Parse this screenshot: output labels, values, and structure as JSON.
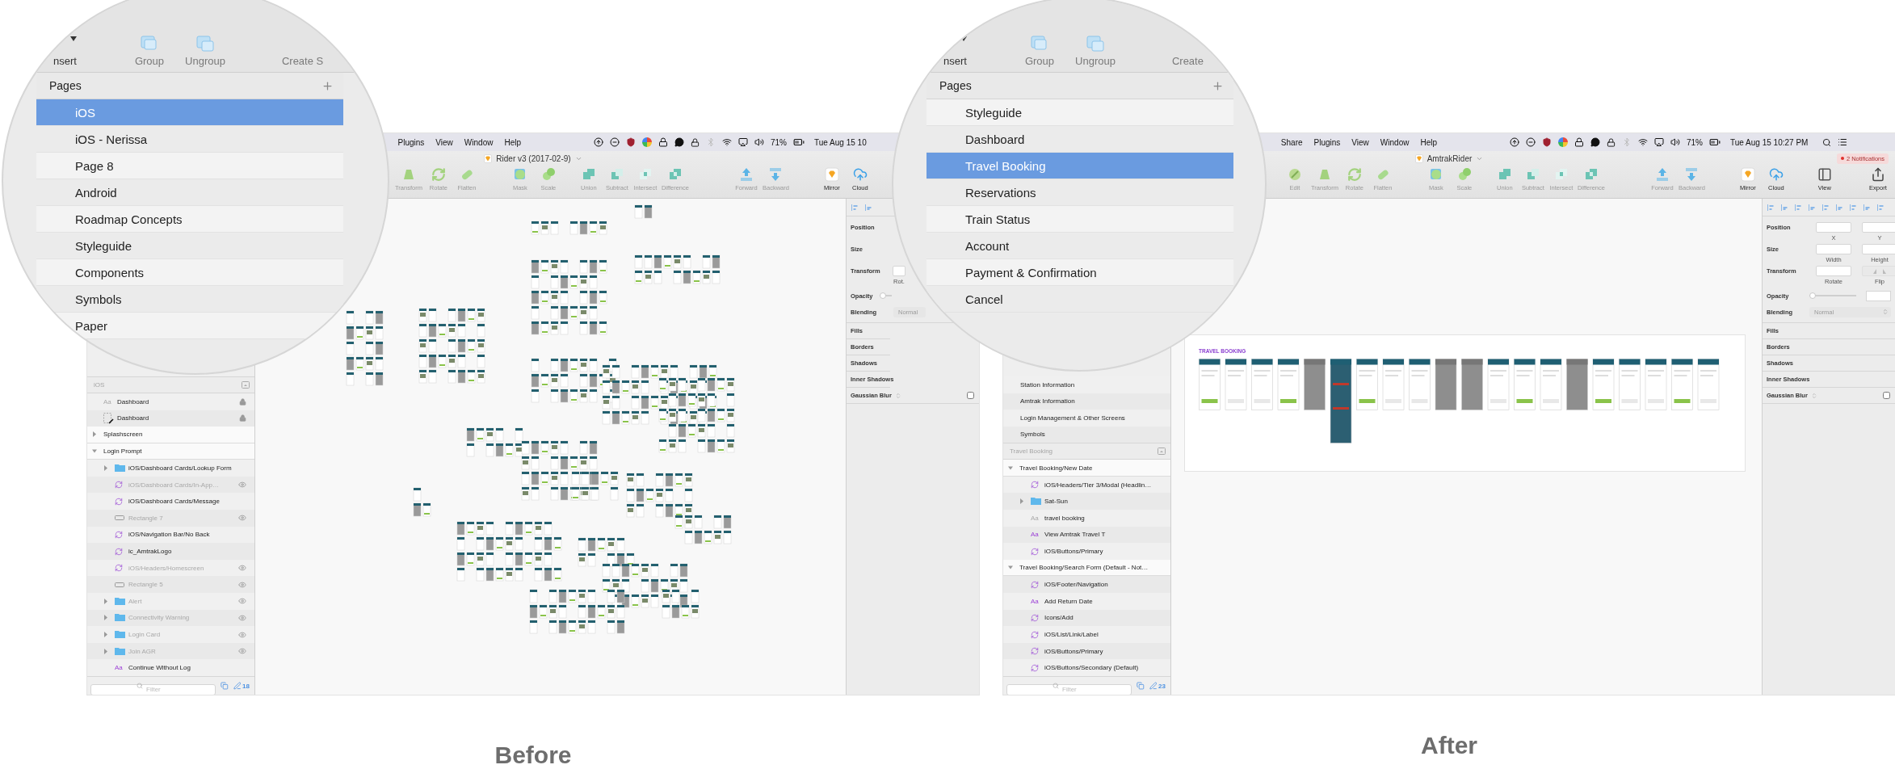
{
  "screenshots": [
    {
      "caption": "Before",
      "window": {
        "menu": [
          "Plugins",
          "View",
          "Window",
          "Help"
        ],
        "battery": "71%",
        "clock": "Tue Aug 15 10",
        "title": "Rider v3 (2017-02-9)",
        "toolbar": [
          [
            {
              "kind": "transform",
              "label": "Transform",
              "disabled": true
            },
            {
              "kind": "rotate",
              "label": "Rotate",
              "disabled": true
            },
            {
              "kind": "flatten",
              "label": "Flatten",
              "disabled": true
            }
          ],
          [
            {
              "kind": "mask",
              "label": "Mask",
              "disabled": true
            },
            {
              "kind": "scale",
              "label": "Scale",
              "disabled": true
            }
          ],
          [
            {
              "kind": "union",
              "label": "Union",
              "disabled": true
            },
            {
              "kind": "subtract",
              "label": "Subtract",
              "disabled": true
            },
            {
              "kind": "intersect",
              "label": "Intersect",
              "disabled": true
            },
            {
              "kind": "difference",
              "label": "Difference",
              "disabled": true
            }
          ],
          [
            {
              "kind": "forward",
              "label": "Forward",
              "disabled": true
            },
            {
              "kind": "backward",
              "label": "Backward",
              "disabled": true
            }
          ],
          [
            {
              "kind": "mirror",
              "label": "Mirror",
              "disabled": false
            },
            {
              "kind": "cloud",
              "label": "Cloud",
              "disabled": false
            }
          ]
        ],
        "sidebar": {
          "layers_title": "iOS",
          "layers": [
            {
              "kind": "text",
              "glyph": "Aa",
              "styled": false,
              "name": "Dashboard",
              "hidden": false,
              "locked": true
            },
            {
              "kind": "slice",
              "name": "Dashboard",
              "hidden": false,
              "locked": true
            },
            {
              "kind": "artboard",
              "name": "Splashscreen",
              "expanded": false,
              "hidden": false,
              "locked": false
            },
            {
              "kind": "artboard",
              "name": "Login Prompt",
              "expanded": true,
              "hidden": false,
              "locked": false,
              "children": [
                {
                  "kind": "folder",
                  "name": "iOS/Dashboard Cards/Lookup Form",
                  "expanded": false,
                  "hidden": false,
                  "locked": false
                },
                {
                  "kind": "symbol",
                  "name": "iOS/Dashboard Cards/In-App…",
                  "hidden": true,
                  "locked": false
                },
                {
                  "kind": "symbol",
                  "name": "iOS/Dashboard Cards/Message",
                  "hidden": false,
                  "locked": false
                },
                {
                  "kind": "shape",
                  "name": "Rectangle 7",
                  "hidden": true,
                  "locked": false
                },
                {
                  "kind": "symbol",
                  "name": "iOS/Navigation Bar/No Back",
                  "hidden": false,
                  "locked": false
                },
                {
                  "kind": "symbol",
                  "name": "ic_AmtrakLogo",
                  "hidden": false,
                  "locked": false
                },
                {
                  "kind": "symbol",
                  "name": "iOS/Headers/Homescreen",
                  "hidden": true,
                  "locked": false
                },
                {
                  "kind": "shape",
                  "name": "Rectangle 5",
                  "hidden": true,
                  "locked": false
                },
                {
                  "kind": "folder",
                  "name": "Alert",
                  "expanded": false,
                  "hidden": true,
                  "locked": false
                },
                {
                  "kind": "folder",
                  "name": "Connectivity Warning",
                  "expanded": false,
                  "hidden": true,
                  "locked": false
                },
                {
                  "kind": "folder",
                  "name": "Login Card",
                  "expanded": false,
                  "hidden": true,
                  "locked": false
                },
                {
                  "kind": "folder",
                  "name": "Join AGR",
                  "expanded": false,
                  "hidden": true,
                  "locked": false
                },
                {
                  "kind": "text",
                  "glyph": "Aa",
                  "styled": true,
                  "name": "Continue Without Log",
                  "hidden": false,
                  "locked": false
                }
              ]
            }
          ],
          "filter": {
            "placeholder": "Filter"
          },
          "count": "18"
        },
        "canvas": {
          "kind": "scattered"
        },
        "inspector": {
          "rows": [
            {
              "label": "Position",
              "fields": []
            },
            {
              "label": "Size",
              "fields": []
            },
            {
              "label": "Transform",
              "fields": [
                {
                  "kind": "input",
                  "caption": "Rot."
                }
              ]
            }
          ],
          "opacity": {
            "label": "Opacity",
            "level": 0
          },
          "blending": {
            "label": "Blending",
            "value": "Normal"
          },
          "sections": [
            {
              "kind": "plain",
              "label": "Fills"
            },
            {
              "kind": "plain",
              "label": "Borders"
            },
            {
              "kind": "plain",
              "label": "Shadows"
            },
            {
              "kind": "plain",
              "label": "Inner Shadows"
            },
            {
              "kind": "toggle",
              "label": "Gaussian Blur",
              "checked": false
            }
          ]
        }
      },
      "magnifier": {
        "insert": "nsert",
        "tools": [
          "Group",
          "Ungroup"
        ],
        "create": "Create S",
        "pages_title": "Pages",
        "pages": [
          {
            "label": "iOS",
            "selected": true
          },
          {
            "label": "iOS - Nerissa",
            "selected": false
          },
          {
            "label": "Page 8",
            "selected": false
          },
          {
            "label": "Android",
            "selected": false
          },
          {
            "label": "Roadmap Concepts",
            "selected": false
          },
          {
            "label": "Styleguide",
            "selected": false
          },
          {
            "label": "Components",
            "selected": false
          },
          {
            "label": "Symbols",
            "selected": false
          },
          {
            "label": "Paper",
            "selected": false
          }
        ]
      }
    },
    {
      "caption": "After",
      "window": {
        "menu": [
          "Share",
          "Plugins",
          "View",
          "Window",
          "Help"
        ],
        "battery": "71%",
        "clock": "Tue Aug 15 10:27 PM",
        "title": "AmtrakRider",
        "notifications": "2 Notifications",
        "toolbar": [
          [
            {
              "kind": "edit",
              "label": "Edit",
              "disabled": true
            },
            {
              "kind": "transform",
              "label": "Transform",
              "disabled": true
            },
            {
              "kind": "rotate",
              "label": "Rotate",
              "disabled": true
            },
            {
              "kind": "flatten",
              "label": "Flatten",
              "disabled": true
            }
          ],
          [
            {
              "kind": "mask",
              "label": "Mask",
              "disabled": true
            },
            {
              "kind": "scale",
              "label": "Scale",
              "disabled": true
            }
          ],
          [
            {
              "kind": "union",
              "label": "Union",
              "disabled": true
            },
            {
              "kind": "subtract",
              "label": "Subtract",
              "disabled": true
            },
            {
              "kind": "intersect",
              "label": "Intersect",
              "disabled": true
            },
            {
              "kind": "difference",
              "label": "Difference",
              "disabled": true
            }
          ],
          [
            {
              "kind": "forward",
              "label": "Forward",
              "disabled": true
            },
            {
              "kind": "backward",
              "label": "Backward",
              "disabled": true
            }
          ],
          [
            {
              "kind": "mirror",
              "label": "Mirror",
              "disabled": false
            },
            {
              "kind": "cloud",
              "label": "Cloud",
              "disabled": false
            }
          ],
          [
            {
              "kind": "view",
              "label": "View",
              "disabled": false
            }
          ],
          [
            {
              "kind": "export",
              "label": "Export",
              "disabled": false
            }
          ]
        ],
        "sidebar": {
          "pages": [
            {
              "name": "Station Information",
              "selected": false
            },
            {
              "name": "Amtrak Information",
              "selected": false
            },
            {
              "name": "Login Management & Other Screens",
              "selected": false
            },
            {
              "name": "Symbols",
              "selected": false
            }
          ],
          "layers_title": "Travel Booking",
          "layers": [
            {
              "kind": "artboard",
              "name": "Travel Booking/New Date",
              "expanded": true,
              "hidden": false,
              "locked": false,
              "children": [
                {
                  "kind": "symbol",
                  "name": "iOS/Headers/Tier 3/Modal (Headlin…",
                  "hidden": false,
                  "locked": false
                },
                {
                  "kind": "folder",
                  "name": "Sat-Sun",
                  "expanded": false,
                  "hidden": false,
                  "locked": false
                },
                {
                  "kind": "text",
                  "glyph": "Aa",
                  "styled": false,
                  "name": "travel booking",
                  "hidden": false,
                  "locked": false
                },
                {
                  "kind": "text",
                  "glyph": "Aa",
                  "styled": true,
                  "name": "View Amtrak Travel T",
                  "hidden": false,
                  "locked": false
                },
                {
                  "kind": "symbol",
                  "name": "iOS/Buttons/Primary",
                  "hidden": false,
                  "locked": false
                }
              ]
            },
            {
              "kind": "artboard",
              "name": "Travel Booking/Search Form (Default - Not…",
              "expanded": true,
              "hidden": false,
              "locked": false,
              "children": [
                {
                  "kind": "symbol",
                  "name": "iOS/Footer/Navigation",
                  "hidden": false,
                  "locked": false
                },
                {
                  "kind": "text",
                  "glyph": "Aa",
                  "styled": true,
                  "name": "Add Return Date",
                  "hidden": false,
                  "locked": false
                },
                {
                  "kind": "symbol",
                  "name": "Icons/Add",
                  "hidden": false,
                  "locked": false
                },
                {
                  "kind": "symbol",
                  "name": "iOS/List/Link/Label",
                  "hidden": false,
                  "locked": false
                },
                {
                  "kind": "symbol",
                  "name": "iOS/Buttons/Primary",
                  "hidden": false,
                  "locked": false
                },
                {
                  "kind": "symbol",
                  "name": "iOS/Buttons/Secondary (Default)",
                  "hidden": false,
                  "locked": false
                }
              ]
            }
          ],
          "filter": {
            "placeholder": "Filter"
          },
          "count": "23"
        },
        "canvas": {
          "kind": "board",
          "board_title": "TRAVEL BOOKING"
        },
        "inspector": {
          "rows": [
            {
              "label": "Position",
              "fields": [
                {
                  "kind": "input",
                  "caption": "X"
                },
                {
                  "kind": "input",
                  "caption": "Y"
                }
              ]
            },
            {
              "label": "Size",
              "fields": [
                {
                  "kind": "input",
                  "caption": "Width"
                },
                {
                  "kind": "input",
                  "caption": "Height"
                }
              ]
            },
            {
              "label": "Transform",
              "fields": [
                {
                  "kind": "input",
                  "caption": "Rotate"
                },
                {
                  "kind": "flip",
                  "caption": "Flip"
                }
              ]
            }
          ],
          "opacity": {
            "label": "Opacity",
            "level": 0
          },
          "blending": {
            "label": "Blending",
            "value": "Normal"
          },
          "sections": [
            {
              "kind": "plain",
              "label": "Fills"
            },
            {
              "kind": "plain",
              "label": "Borders"
            },
            {
              "kind": "plain",
              "label": "Shadows"
            },
            {
              "kind": "plain",
              "label": "Inner Shadows"
            },
            {
              "kind": "toggle",
              "label": "Gaussian Blur",
              "checked": false
            }
          ]
        }
      },
      "magnifier": {
        "insert": "nsert",
        "tools": [
          "Group",
          "Ungroup"
        ],
        "create": "Create",
        "pages_title": "Pages",
        "pages": [
          {
            "label": "Styleguide",
            "selected": false
          },
          {
            "label": "Dashboard",
            "selected": false
          },
          {
            "label": "Travel Booking",
            "selected": true
          },
          {
            "label": "Reservations",
            "selected": false
          },
          {
            "label": "Train Status",
            "selected": false
          },
          {
            "label": "Account",
            "selected": false
          },
          {
            "label": "Payment & Confirmation",
            "selected": false
          },
          {
            "label": "Cancel",
            "selected": false
          }
        ]
      }
    }
  ]
}
